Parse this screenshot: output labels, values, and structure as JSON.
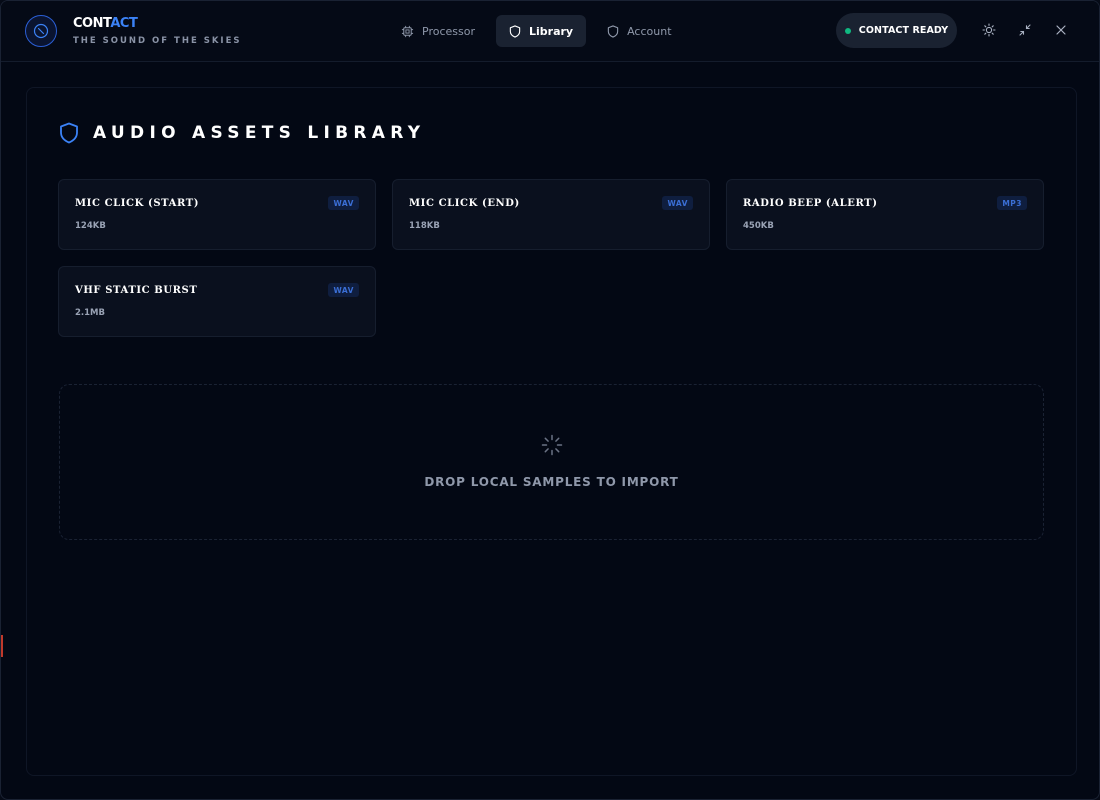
{
  "app": {
    "name_prefix": "CONT",
    "name_accent": "ACT",
    "tagline": "THE SOUND OF THE SKIES"
  },
  "nav": {
    "tabs": [
      {
        "label": "Processor",
        "icon": "chip-icon",
        "active": false
      },
      {
        "label": "Library",
        "icon": "shield-icon",
        "active": true
      },
      {
        "label": "Account",
        "icon": "shield-icon",
        "active": false
      }
    ]
  },
  "status": {
    "label": "CONTACT READY",
    "color": "#10b981"
  },
  "window_controls": {
    "icons": [
      "sun-icon",
      "minimize-arrows-icon",
      "close-icon"
    ]
  },
  "library": {
    "title": "AUDIO ASSETS LIBRARY",
    "title_icon": "shield-icon",
    "assets": [
      {
        "name": "MIC CLICK (START)",
        "size": "124KB",
        "format": "WAV"
      },
      {
        "name": "MIC CLICK (END)",
        "size": "118KB",
        "format": "WAV"
      },
      {
        "name": "RADIO BEEP (ALERT)",
        "size": "450KB",
        "format": "MP3"
      },
      {
        "name": "VHF STATIC BURST",
        "size": "2.1MB",
        "format": "WAV"
      }
    ],
    "dropzone_label": "DROP LOCAL SAMPLES TO IMPORT",
    "dropzone_icon": "loader-icon"
  },
  "colors": {
    "accent": "#3b82f6",
    "background": "#030814",
    "card": "#0a101e",
    "status_ok": "#10b981"
  }
}
